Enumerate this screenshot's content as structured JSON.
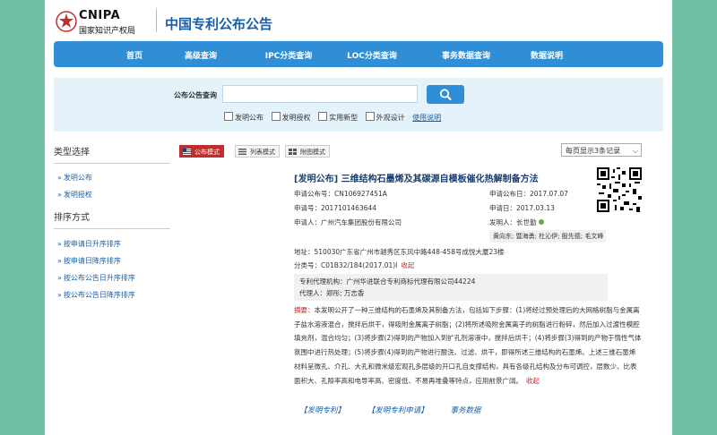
{
  "header": {
    "logo_text": "CNIPA",
    "logo_subtext": "国家知识产权局",
    "site_title": "中国专利公布公告"
  },
  "nav": {
    "items": [
      "首页",
      "高级查询",
      "IPC分类查询",
      "LOC分类查询",
      "事务数据查询",
      "数据说明"
    ]
  },
  "search": {
    "label": "公布公告查询",
    "input_value": "",
    "options": [
      "发明公布",
      "发明授权",
      "实用新型",
      "外观设计"
    ],
    "help_link": "使用说明"
  },
  "sidebar": {
    "type_heading": "类型选择",
    "type_items": [
      "发明公布",
      "发明授权"
    ],
    "sort_heading": "排序方式",
    "sort_items": [
      "按申请日升序排序",
      "按申请日降序排序",
      "按公布公告日升序排序",
      "按公布公告日降序排序"
    ]
  },
  "views": {
    "public_mode": "公布模式",
    "list_mode": "列表模式",
    "figure_mode": "附图模式",
    "per_page": "每页显示3条记录"
  },
  "record": {
    "title": "[发明公布] 三维结构石墨烯及其碳源自模板催化热解制备方法",
    "pub_no_label": "申请公布号：",
    "pub_no": "CN106927451A",
    "pub_date_label": "申请公布日：",
    "pub_date": "2017.07.07",
    "app_no_label": "申请号：",
    "app_no": "2017101463644",
    "app_date_label": "申请日：",
    "app_date": "2017.03.13",
    "applicant_label": "申请人：",
    "applicant": "广州汽车集团股份有限公司",
    "inventor_label": "发明人：",
    "inventor": "长世勤",
    "inventors_more": "黄向东; 暨海勇; 杜沁伊; 殷先德; 毛文峰",
    "address_label": "地址：",
    "address": "510030广东省广州市越秀区东风中路448-458号成悦大厦23楼",
    "class_label": "分类号：",
    "class_no": "C01B32/184(2017.01)I",
    "collapse": "收起",
    "agency_label": "专利代理机构：",
    "agency": "广州华进联合专利商标代理有限公司44224",
    "agent_label": "代理人：",
    "agent": "郑彤; 万志香",
    "abstract_label": "摘要：",
    "abstract": "本发明公开了一种三维结构的石墨烯及其制备方法，包括如下步骤：(1)将经过预处理后的大网格树脂与金属离子盐水溶液混合，搅拌后烘干，得吸附金属离子树脂；(2)将所述吸附金属离子的树脂进行粉碎，然后加入过渡性模腔填充剂，混合均匀；(3)将步骤(2)得到的产物加入到扩孔剂溶液中，搅拌后烘干；(4)将步骤(3)得到的产物于惰性气体氛围中进行热处理；(5)将步骤(4)得到的产物进行酸洗、过滤、烘干，即得所述三维结构的石墨烯。上述三维石墨烯材料呈微孔、介孔、大孔和微米级宏观孔多层级的开口孔自支撑结构，具有各级孔结构及分布可调控，层数少、比表面积大、孔隙率高和电导率高、密度低、不易再堆叠等特点，应用前景广阔。",
    "abstract_collapse": "收起",
    "links": [
      "【发明专利】",
      "【发明专利申请】",
      "事务数据"
    ]
  },
  "colors": {
    "nav_blue": "#2f8ed5",
    "active_red": "#c12c2c",
    "background_green": "#6fc0a5",
    "link_blue": "#1a5fa3"
  }
}
